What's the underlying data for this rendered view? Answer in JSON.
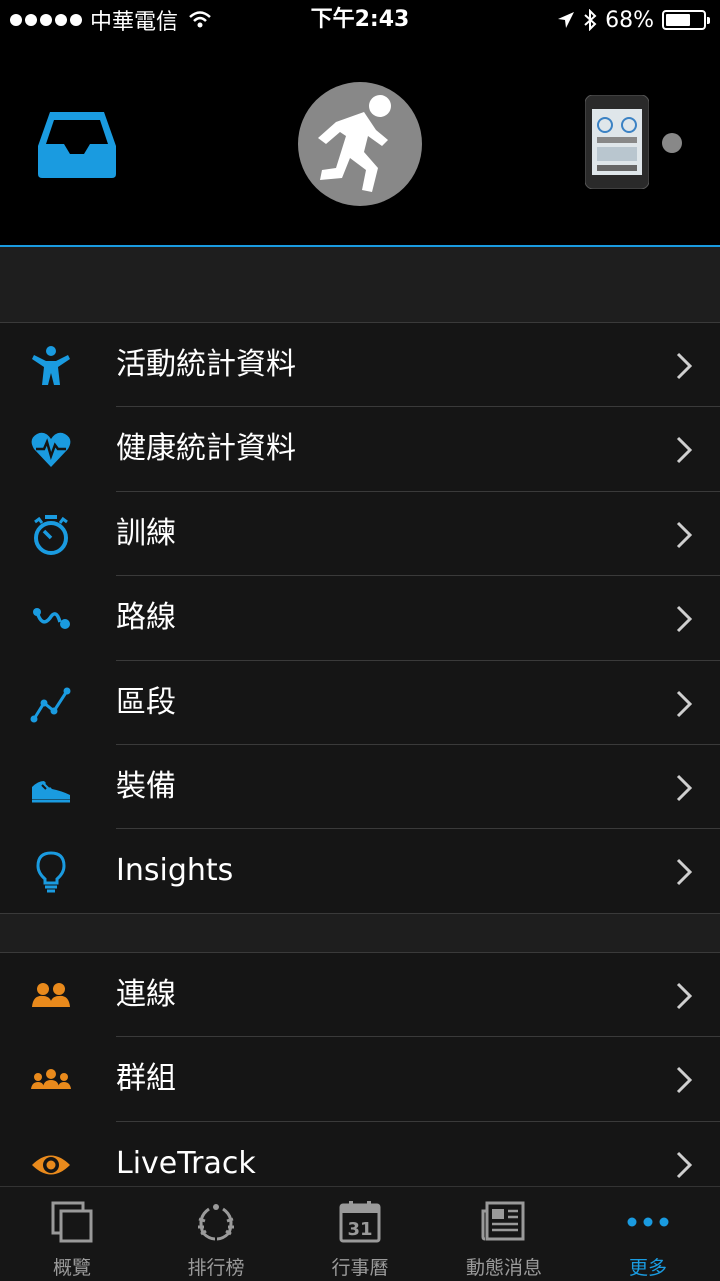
{
  "status_bar": {
    "carrier": "中華電信",
    "time": "下午2:43",
    "battery": "68%",
    "battery_level": 0.68
  },
  "menu_group1": [
    {
      "label": "活動統計資料",
      "icon": "activity-person-icon"
    },
    {
      "label": "健康統計資料",
      "icon": "heart-rate-icon"
    },
    {
      "label": "訓練",
      "icon": "stopwatch-icon"
    },
    {
      "label": "路線",
      "icon": "course-icon"
    },
    {
      "label": "區段",
      "icon": "segment-icon"
    },
    {
      "label": "裝備",
      "icon": "shoe-icon"
    },
    {
      "label": "Insights",
      "icon": "lightbulb-icon"
    }
  ],
  "menu_group2": [
    {
      "label": "連線",
      "icon": "connections-icon"
    },
    {
      "label": "群組",
      "icon": "groups-icon"
    },
    {
      "label": "LiveTrack",
      "icon": "eye-icon"
    }
  ],
  "tabbar": [
    {
      "label": "概覽",
      "icon": "overview-icon"
    },
    {
      "label": "排行榜",
      "icon": "laurel-icon"
    },
    {
      "label": "行事曆",
      "icon": "calendar-icon",
      "day": "31"
    },
    {
      "label": "動態消息",
      "icon": "newsfeed-icon"
    },
    {
      "label": "更多",
      "icon": "more-icon",
      "active": true
    }
  ],
  "colors": {
    "accent": "#1a9be0",
    "orange": "#e98a1c",
    "background": "#151515"
  }
}
